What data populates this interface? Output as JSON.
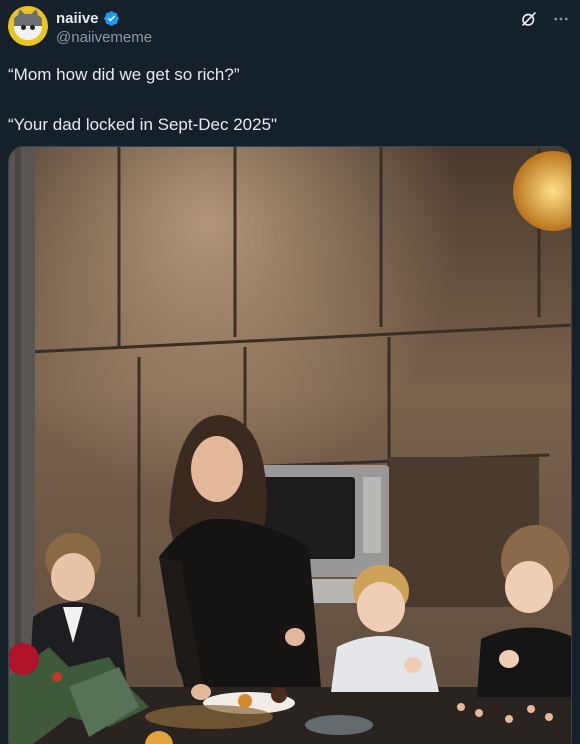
{
  "author": {
    "display_name": "naiive",
    "handle": "@naiivememe",
    "verified": true,
    "avatar_icon": "cat-face-avatar"
  },
  "actions": {
    "grok_icon": "slashed-circle-icon",
    "more_icon": "more-horizontal-icon"
  },
  "tweet": {
    "line1": "“Mom how did we get so rich?”",
    "line2": "“Your dad locked in Sept-Dec 2025\""
  },
  "media": {
    "description_icon": "photo"
  },
  "colors": {
    "background": "#15202b",
    "text": "#e7e9ea",
    "secondary": "#8b98a5",
    "verified_blue": "#1d9bf0"
  }
}
